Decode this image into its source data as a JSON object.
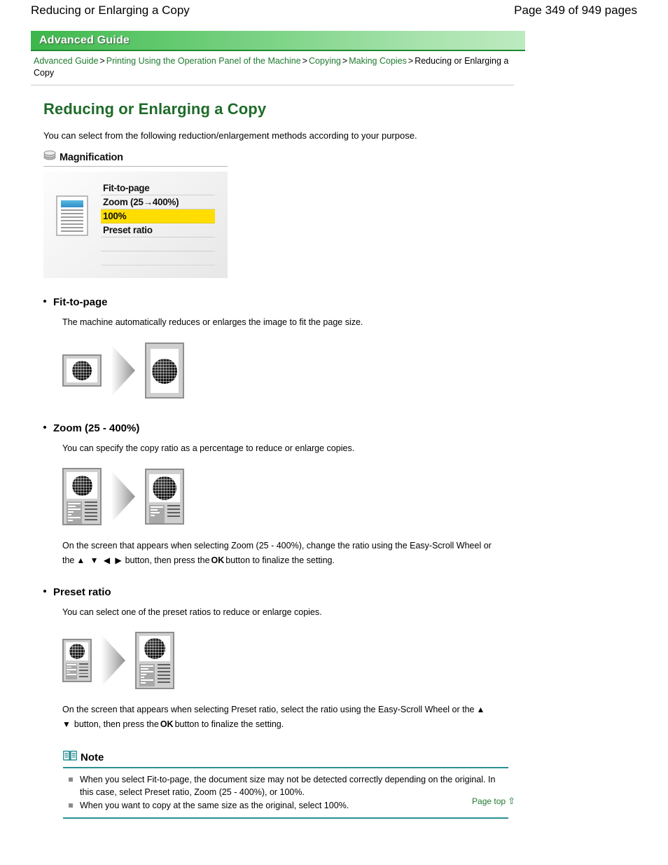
{
  "header": {
    "doc_title": "Reducing or Enlarging a Copy",
    "page_count": "Page 349 of 949 pages"
  },
  "banner": {
    "label": "Advanced Guide"
  },
  "breadcrumb": {
    "items": [
      {
        "label": "Advanced Guide",
        "link": true
      },
      {
        "label": "Printing Using the Operation Panel of the Machine",
        "link": true
      },
      {
        "label": "Copying",
        "link": true
      },
      {
        "label": "Making Copies",
        "link": true
      },
      {
        "label": "Reducing or Enlarging a Copy",
        "link": false
      }
    ],
    "separator": ">"
  },
  "topic": {
    "title": "Reducing or Enlarging a Copy",
    "intro": "You can select from the following reduction/enlargement methods according to your purpose."
  },
  "lcd": {
    "title": "Magnification",
    "icon": "layers-icon",
    "menu_items": [
      {
        "label": "Fit-to-page",
        "selected": false
      },
      {
        "label": "Zoom (25→400%)",
        "selected": false
      },
      {
        "label": "100%",
        "selected": true
      },
      {
        "label": "Preset ratio",
        "selected": false
      }
    ],
    "highlight_color": "#ffdd00"
  },
  "sections": [
    {
      "heading": "Fit-to-page",
      "body": "The machine automatically reduces or enlarges the image to fit the page size.",
      "follow": null
    },
    {
      "heading": "Zoom (25 - 400%)",
      "body": "You can specify the copy ratio as a percentage to reduce or enlarge copies.",
      "follow_part1": "On the screen that appears when selecting Zoom (25 - 400%), change the ratio using the Easy-Scroll Wheel or the",
      "follow_arrows": "▲ ▼ ◀ ▶",
      "follow_part2": "button, then press the",
      "follow_ok": "OK",
      "follow_part3": "button to finalize the setting."
    },
    {
      "heading": "Preset ratio",
      "body": "You can select one of the preset ratios to reduce or enlarge copies.",
      "follow_part1": "On the screen that appears when selecting Preset ratio, select the ratio using the Easy-Scroll Wheel or the",
      "follow_arrows": "▲ ▼",
      "follow_part2": "button, then press the",
      "follow_ok": "OK",
      "follow_part3": "button to finalize the setting."
    }
  ],
  "note": {
    "label": "Note",
    "icon": "book-icon",
    "accent_color": "#2a8f92",
    "items": [
      "When you select Fit-to-page, the document size may not be detected correctly depending on the original. In this case, select Preset ratio, Zoom (25 - 400%), or 100%.",
      "When you want to copy at the same size as the original, select 100%."
    ]
  },
  "footer": {
    "page_top_label": "Page top",
    "page_top_arrow": "⇧"
  }
}
